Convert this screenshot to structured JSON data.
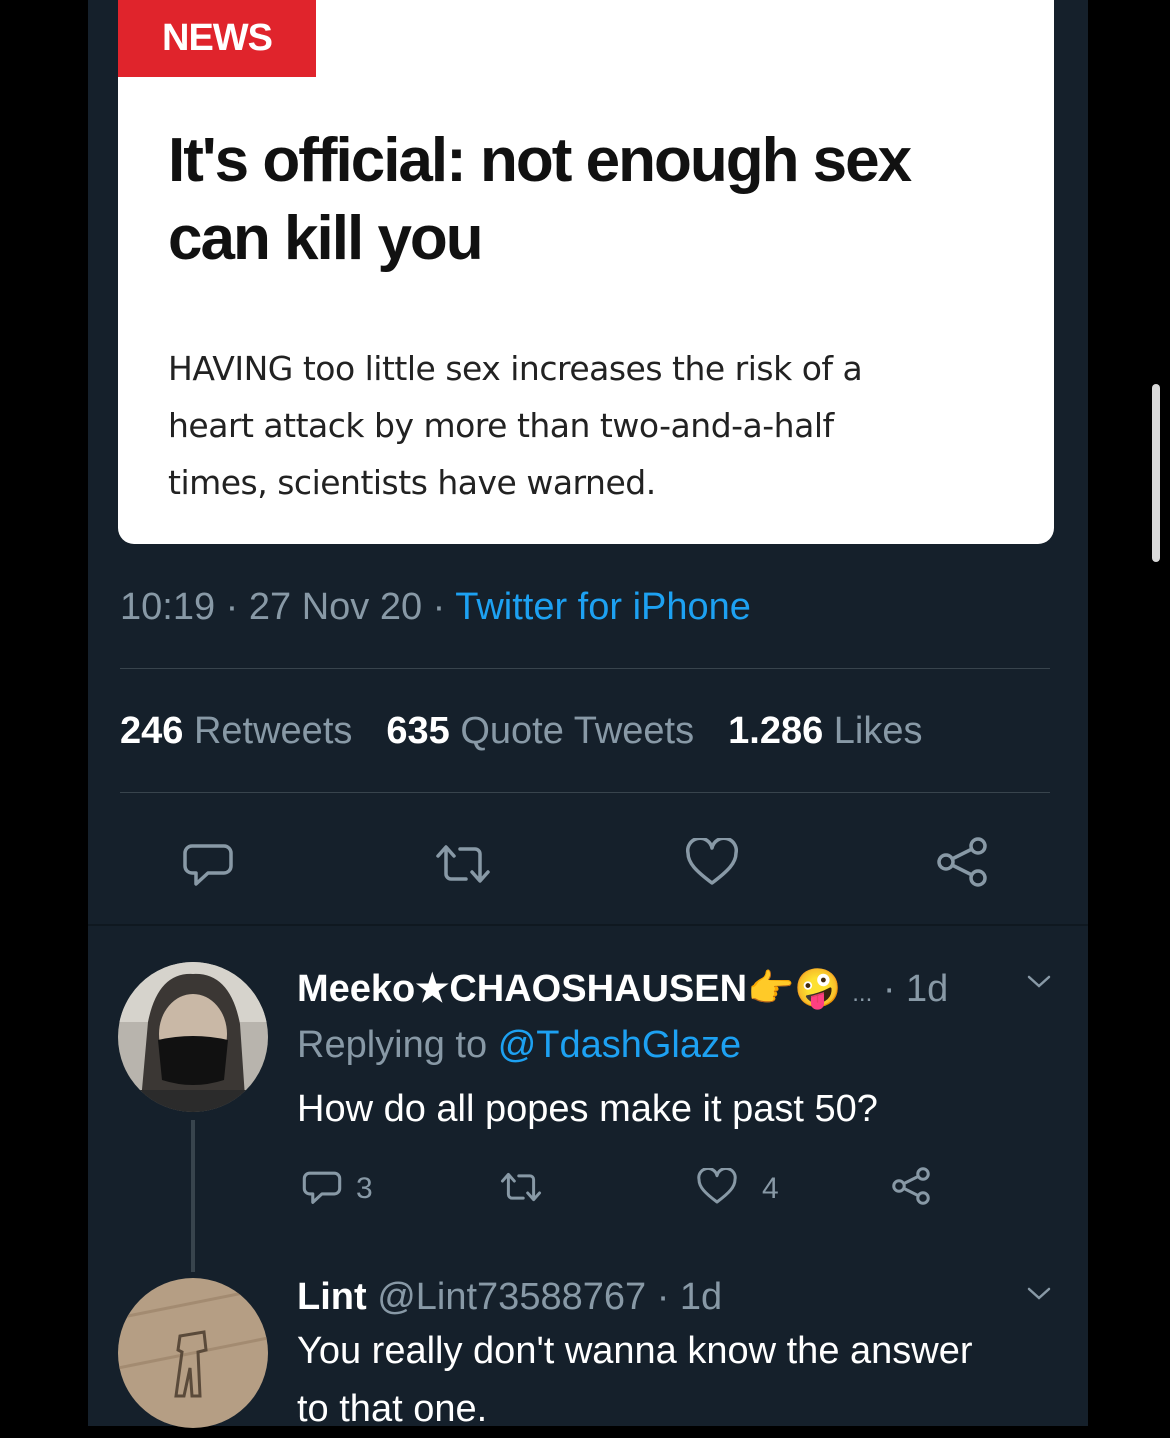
{
  "article": {
    "tag": "NEWS",
    "headline_line1": "It's official: not enough sex",
    "headline_line2": "can kill you",
    "lede_line1": "HAVING too little sex increases the risk of a",
    "lede_line2": "heart attack by more than two-and-a-half",
    "lede_line3": "times, scientists have warned."
  },
  "tweet": {
    "time": "10:19",
    "date": "27 Nov 20",
    "separator": " · ",
    "source": "Twitter for iPhone",
    "retweets_count": "246",
    "retweets_label": "Retweets",
    "quotes_count": "635",
    "quotes_label": "Quote Tweets",
    "likes_count": "1.286",
    "likes_label": "Likes"
  },
  "replies": [
    {
      "name": "Meeko★CHAOSHAUSEN",
      "emoji": "👉🤪",
      "ellipsis": "...",
      "age": "· 1d",
      "replying_prefix": "Replying to",
      "replying_handle": "@TdashGlaze",
      "text": "How do all popes make it past 50?",
      "reply_count": "3",
      "like_count": "4"
    },
    {
      "name": "Lint",
      "handle": "@Lint73588767",
      "age": "· 1d",
      "text_line1": "You really don't wanna know the answer",
      "text_line2": "to that one."
    }
  ],
  "icons": [
    "reply-icon",
    "retweet-icon",
    "like-icon",
    "share-icon",
    "chevron-down-icon"
  ],
  "colors": {
    "accent": "#1da1f2",
    "background": "#15202b",
    "news_red": "#e0242c"
  }
}
